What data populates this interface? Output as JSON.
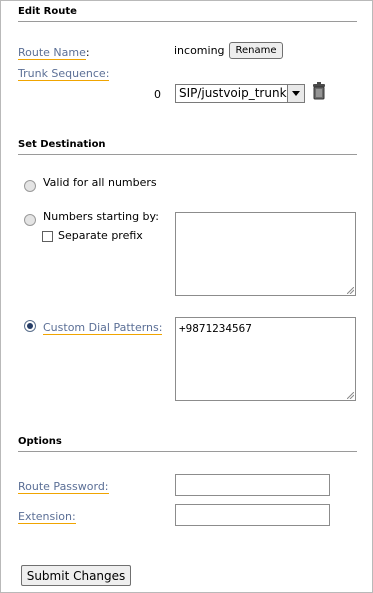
{
  "edit_route": {
    "title": "Edit Route",
    "route_name_label": "Route Name",
    "route_name_value": "incoming",
    "rename_button": "Rename",
    "trunk_sequence_label": "Trunk Sequence:",
    "trunk_index": "0",
    "trunk_selected": "SIP/justvoip_trunk"
  },
  "set_destination": {
    "title": "Set Destination",
    "valid_all_label": "Valid for all numbers",
    "numbers_starting_label": "Numbers starting by:",
    "separate_prefix_label": "Separate prefix",
    "custom_dial_label": "Custom Dial Patterns:",
    "custom_dial_value": "+9871234567",
    "selected_option": "custom_dial_patterns"
  },
  "options": {
    "title": "Options",
    "route_password_label": "Route Password:",
    "extension_label": "Extension:"
  },
  "submit_label": "Submit Changes",
  "icons": {
    "delete": "trash-icon",
    "dropdown": "chevron-down-icon"
  }
}
